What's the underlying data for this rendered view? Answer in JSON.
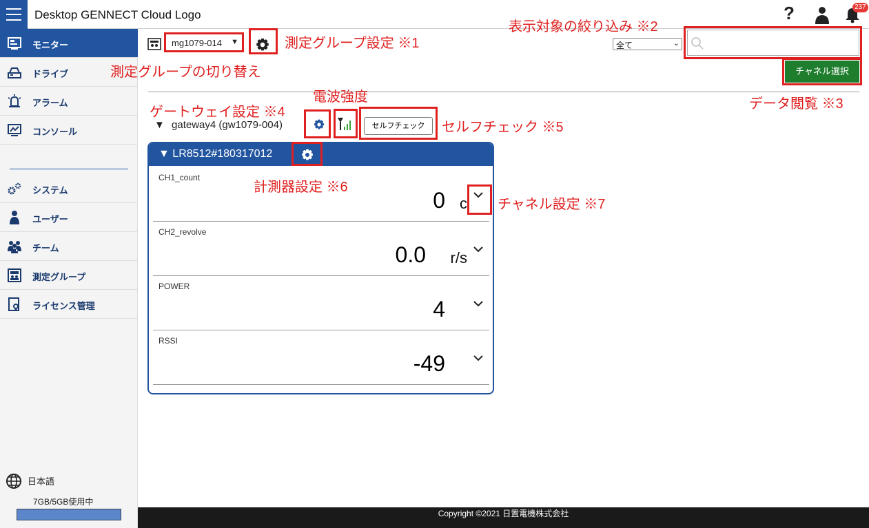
{
  "header": {
    "title": "Desktop GENNECT Cloud Logo",
    "help": "?",
    "notif_count": "237"
  },
  "sidebar": {
    "items": [
      {
        "label": "モニター"
      },
      {
        "label": "ドライブ"
      },
      {
        "label": "アラーム"
      },
      {
        "label": "コンソール"
      },
      {
        "label": "システム"
      },
      {
        "label": "ユーザー"
      },
      {
        "label": "チーム"
      },
      {
        "label": "測定グループ"
      },
      {
        "label": "ライセンス管理"
      }
    ],
    "language": "日本語",
    "usage": "7GB/5GB使用中",
    "usage_fraction": 1.0
  },
  "toolbar": {
    "group_value": "mg1079-014",
    "filter_value": "全て",
    "search_placeholder": "",
    "channel_button": "チャネル選択"
  },
  "gateway": {
    "label": "gateway4 (gw1079-004)",
    "selfcheck": "セルフチェック"
  },
  "device": {
    "label": "LR8512#180317012",
    "channels": [
      {
        "name": "CH1_count",
        "value": "0",
        "unit": "c"
      },
      {
        "name": "CH2_revolve",
        "value": "0.0",
        "unit": "r/s"
      },
      {
        "name": "POWER",
        "value": "4",
        "unit": ""
      },
      {
        "name": "RSSI",
        "value": "-49",
        "unit": ""
      }
    ]
  },
  "annotations": {
    "a1": "測定グループ設定 ※1",
    "a_switch": "測定グループの切り替え",
    "a2": "表示対象の絞り込み ※2",
    "a3": "データ閲覧 ※3",
    "a_radio": "電波強度",
    "a4": "ゲートウェイ設定 ※4",
    "a5": "セルフチェック ※5",
    "a6": "計測器設定 ※6",
    "a7": "チャネル設定 ※7"
  },
  "footer": {
    "copyright": "Copyright ©2021 日置電機株式会社"
  },
  "colors": {
    "accent": "#2255a0",
    "annotation": "#e02020",
    "green": "#1e7e2e"
  }
}
